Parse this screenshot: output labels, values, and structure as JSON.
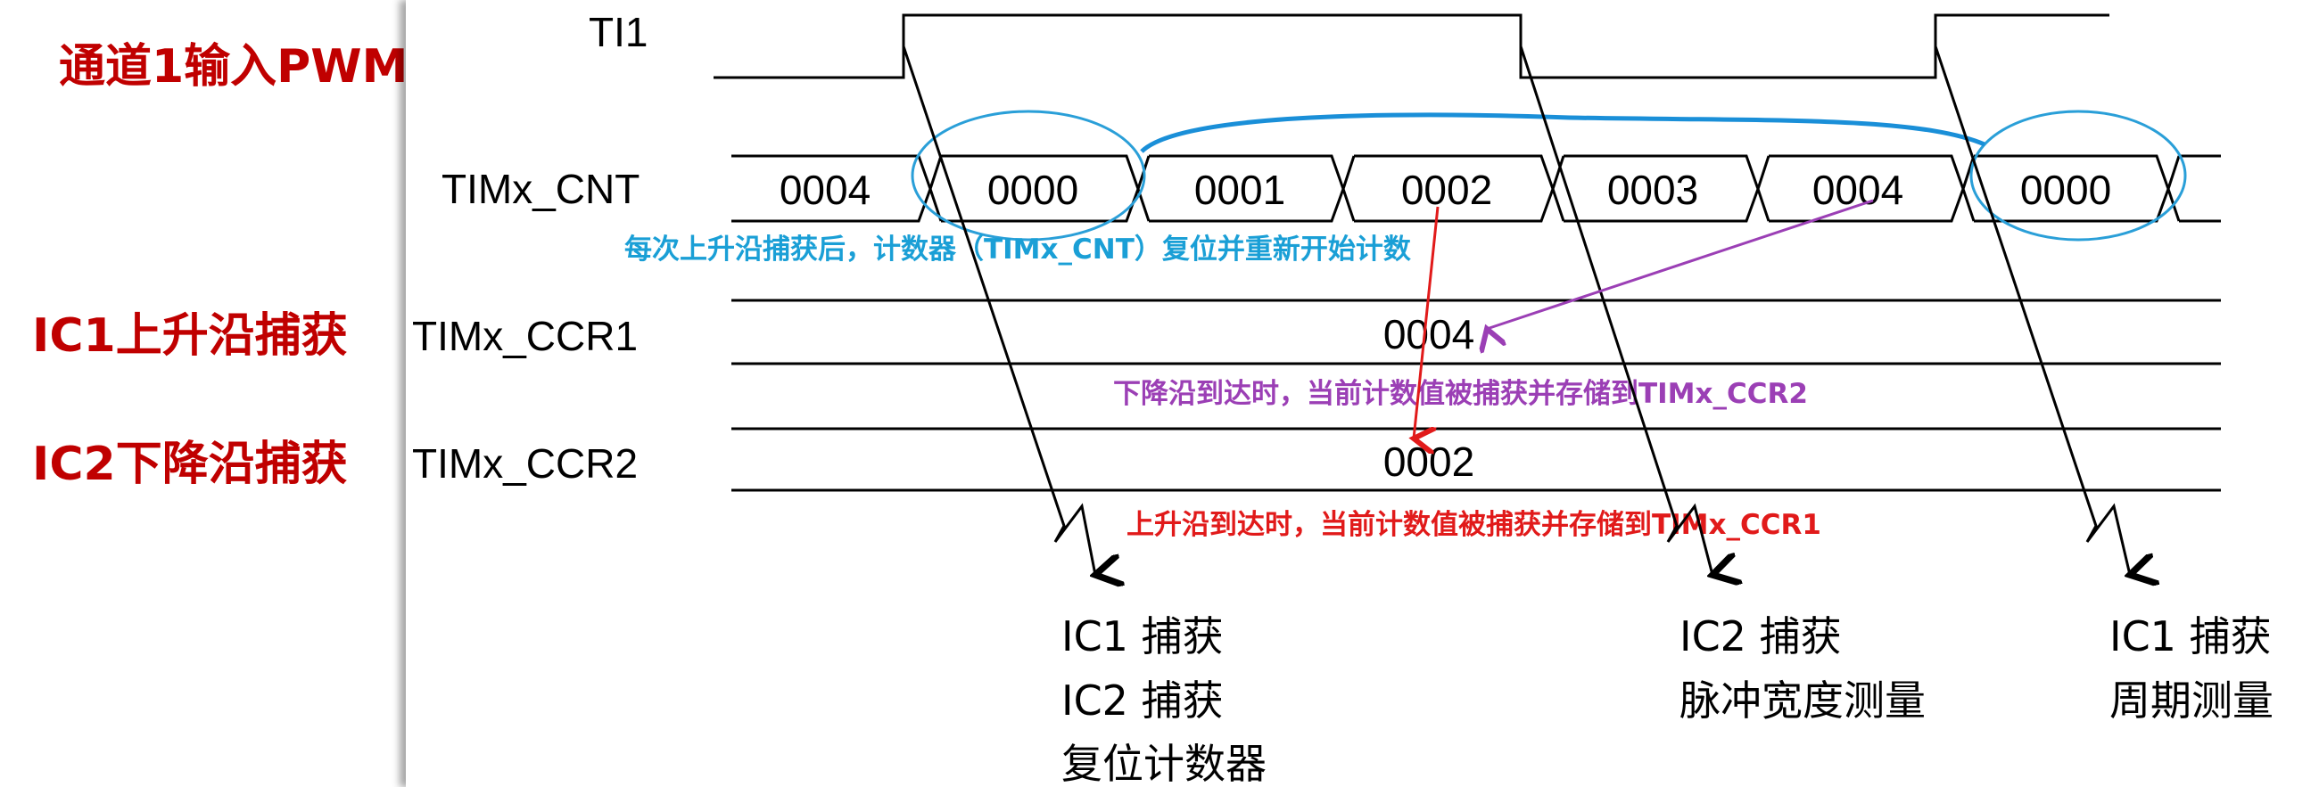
{
  "left_labels": {
    "ch1": "通道1输入PWM",
    "ic1": "IC1上升沿捕获",
    "ic2": "IC2下降沿捕获"
  },
  "signals": {
    "ti1": "TI1",
    "cnt": "TIMx_CNT",
    "ccr1": "TIMx_CCR1",
    "ccr2": "TIMx_CCR2"
  },
  "cnt_values": [
    "0004",
    "0000",
    "0001",
    "0002",
    "0003",
    "0004",
    "0000"
  ],
  "ccr1_value": "0004",
  "ccr2_value": "0002",
  "notes": {
    "reset": "每次上升沿捕获后，计数器（TIMx_CNT）复位并重新开始计数",
    "falling": "下降沿到达时，当前计数值被捕获并存储到TIMx_CCR2",
    "rising": "上升沿到达时，当前计数值被捕获并存储到TIMx_CCR1"
  },
  "events": {
    "e1_line1": "IC1 捕获",
    "e1_line2": "IC2 捕获",
    "e1_line3": "复位计数器",
    "e2_line1": "IC2 捕获",
    "e2_line2": "脉冲宽度测量",
    "e3_line1": "IC1 捕获",
    "e3_line2": "周期测量"
  },
  "colors": {
    "red_label": "#c00000",
    "note_blue": "#1a9fd6",
    "note_purple": "#9b3fb5",
    "note_red": "#e11a1a",
    "circle_blue": "#2a9fd8",
    "connector_blue": "#1a8fd8"
  }
}
